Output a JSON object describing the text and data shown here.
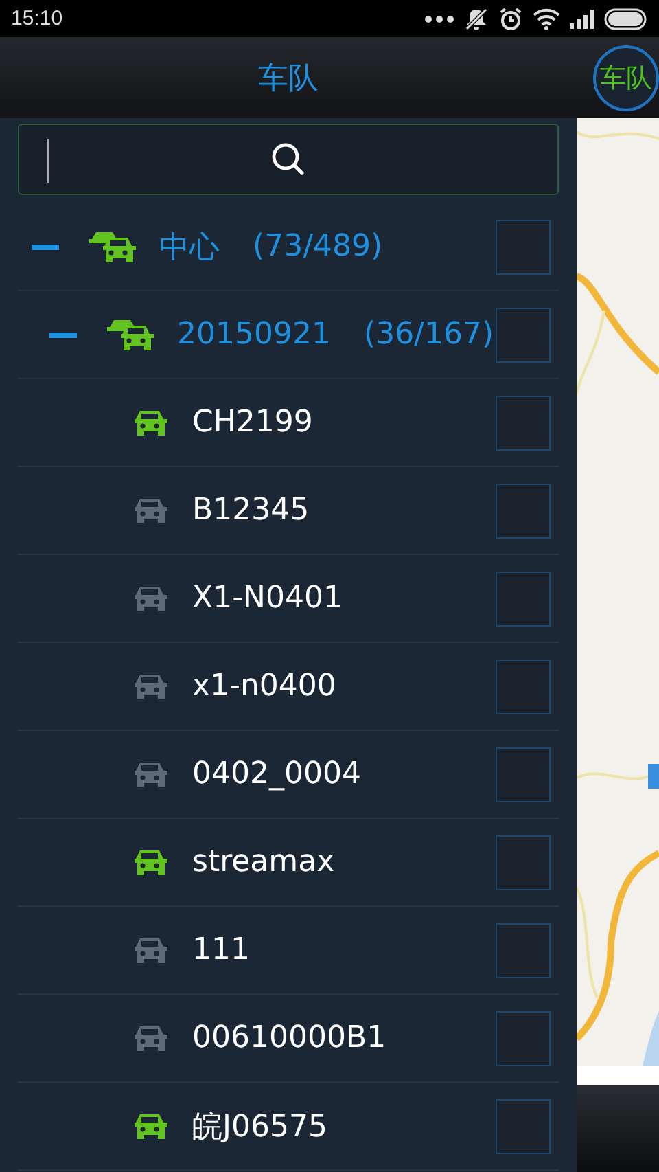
{
  "status_bar": {
    "time": "15:10"
  },
  "header": {
    "title": "车队",
    "side_button": "车队"
  },
  "tree": [
    {
      "kind": "group",
      "name": "中心",
      "count": "(73/489)",
      "expanded": true,
      "checked": false,
      "children": [
        {
          "kind": "group",
          "name": "20150921",
          "count": "(36/167)",
          "expanded": true,
          "checked": false,
          "children": [
            {
              "kind": "vehicle",
              "name": "CH2199",
              "online": true,
              "checked": false
            },
            {
              "kind": "vehicle",
              "name": "B12345",
              "online": false,
              "checked": false
            },
            {
              "kind": "vehicle",
              "name": "X1-N0401",
              "online": false,
              "checked": false
            },
            {
              "kind": "vehicle",
              "name": "x1-n0400",
              "online": false,
              "checked": false
            },
            {
              "kind": "vehicle",
              "name": "0402_0004",
              "online": false,
              "checked": false
            },
            {
              "kind": "vehicle",
              "name": "streamax",
              "online": true,
              "checked": false
            },
            {
              "kind": "vehicle",
              "name": "111",
              "online": false,
              "checked": false
            },
            {
              "kind": "vehicle",
              "name": "00610000B1",
              "online": false,
              "checked": false
            },
            {
              "kind": "vehicle",
              "name": "皖J06575",
              "online": true,
              "checked": false
            }
          ]
        }
      ]
    }
  ]
}
